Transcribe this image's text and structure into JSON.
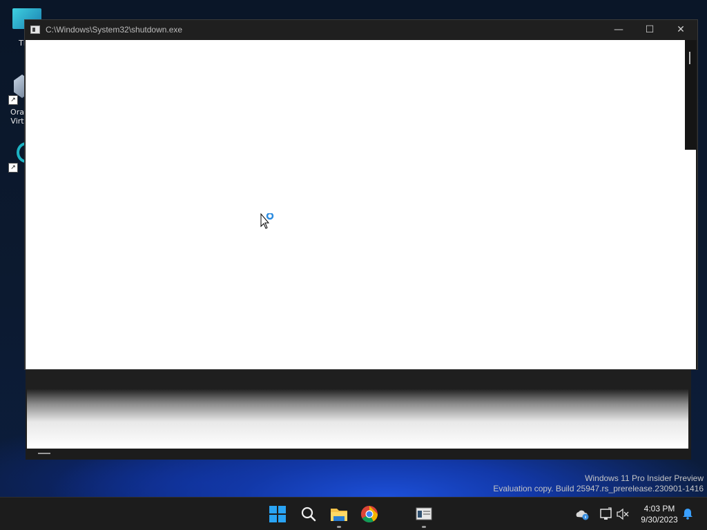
{
  "desktop": {
    "icons": [
      {
        "label": "Th",
        "icon": "teal-folder-icon"
      },
      {
        "label": "Ora Virt",
        "icon": "virtualbox-icon"
      },
      {
        "label": "",
        "icon": "app-ring-icon"
      }
    ]
  },
  "window": {
    "title": "C:\\Windows\\System32\\shutdown.exe",
    "minimize_glyph": "—",
    "maximize_glyph": "☐",
    "close_glyph": "✕"
  },
  "watermark": {
    "line1": "Windows 11 Pro Insider Preview",
    "line2": "Evaluation copy. Build 25947.rs_prerelease.230901-1416"
  },
  "taskbar": {
    "items": [
      {
        "name": "start",
        "icon": "windows-logo-icon"
      },
      {
        "name": "search",
        "icon": "search-icon"
      },
      {
        "name": "file-explorer",
        "icon": "folder-icon",
        "running": true
      },
      {
        "name": "chrome",
        "icon": "chrome-icon"
      },
      {
        "name": "shutdown-window",
        "icon": "console-window-icon",
        "running": true
      }
    ],
    "tray": {
      "time": "4:03 PM",
      "date": "9/30/2023"
    }
  },
  "colors": {
    "accent": "#2aa4f4",
    "taskbar": "#1c1c1c",
    "titlebar": "#1f1f1f"
  }
}
